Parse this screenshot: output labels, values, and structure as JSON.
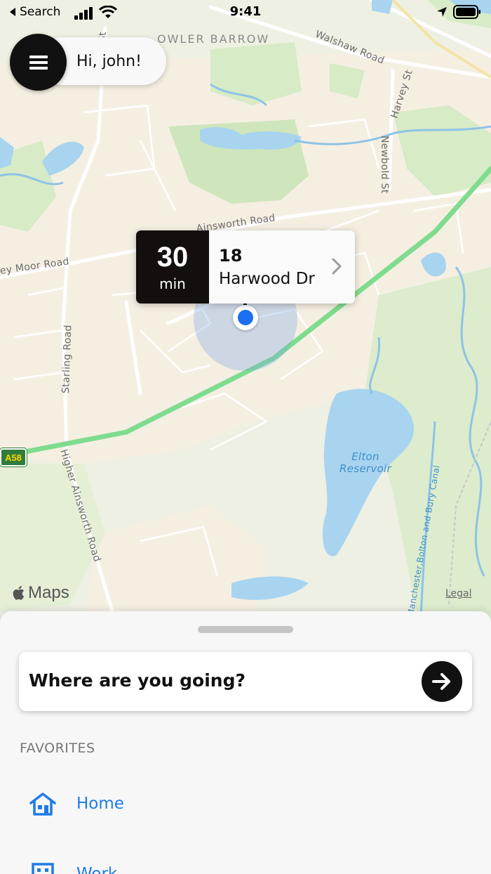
{
  "status_bar": {
    "back_label": "Search",
    "time": "9:41"
  },
  "greeting": {
    "text": "Hi, john!"
  },
  "map": {
    "labels": {
      "area": "OWLER BARROW",
      "walshaw": "Walshaw Road",
      "harvey": "Harvey St",
      "newbold": "Newbold St",
      "ainsworth": "Ainsworth Road",
      "moor": "ey Moor Road",
      "starling": "Starling Road",
      "higher_ainsworth": "Higher Ainsworth Road",
      "reservoir_line1": "Elton",
      "reservoir_line2": "Reservoir",
      "canal": "Manchester,Bolton and Bury Canal",
      "st_top": "St",
      "a58": "A58"
    },
    "attribution": "Maps",
    "legal": "Legal"
  },
  "eta_callout": {
    "minutes": "30",
    "unit": "min",
    "house_number": "18",
    "street": "Harwood Dr"
  },
  "sheet": {
    "search_prompt": "Where are you going?",
    "favorites_heading": "FAVORITES",
    "favorites": [
      {
        "label": "Home",
        "icon": "home-icon"
      },
      {
        "label": "Work",
        "icon": "work-icon"
      }
    ]
  },
  "colors": {
    "accent": "#1f7be8",
    "route": "#7fdc8f",
    "water": "#a8d4f0",
    "park": "#d3e8c1",
    "dark": "#111111"
  }
}
